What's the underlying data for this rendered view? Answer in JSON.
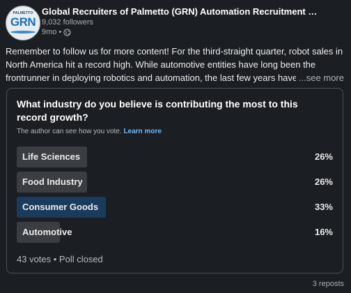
{
  "post": {
    "author_name": "Global Recruiters of Palmetto (GRN) Automation Recruitment Specia...",
    "avatar_top_text": "PALMETTO",
    "avatar_letters": "GRN",
    "followers": "9,032 followers",
    "time_ago": "9mo",
    "meta_separator": "•",
    "visibility_icon": "globe-icon",
    "text": "Remember to follow us for more content! For the third-straight quarter, robot sales in North America hit a record high. While automotive entities have long been the frontrunner in deploying robotics and automation, the last few years have s",
    "see_more_label": "...see more"
  },
  "poll": {
    "question": "What industry do you believe is contributing the most to this record growth?",
    "author_note": "The author can see how you vote.",
    "learn_more": "Learn more",
    "options": [
      {
        "label": "Life Sciences",
        "percent_text": "26%",
        "fraction": 0.26,
        "selected": false
      },
      {
        "label": "Food Industry",
        "percent_text": "26%",
        "fraction": 0.26,
        "selected": false
      },
      {
        "label": "Consumer Goods",
        "percent_text": "33%",
        "fraction": 0.33,
        "selected": true
      },
      {
        "label": "Automotive",
        "percent_text": "16%",
        "fraction": 0.16,
        "selected": false
      }
    ],
    "footer": "43 votes • Poll closed"
  },
  "social": {
    "reposts": "3 reposts"
  },
  "colors": {
    "background": "#1b1f23",
    "bar": "#3a3e42",
    "bar_selected": "#1a3c5c",
    "link": "#71b7fb"
  }
}
